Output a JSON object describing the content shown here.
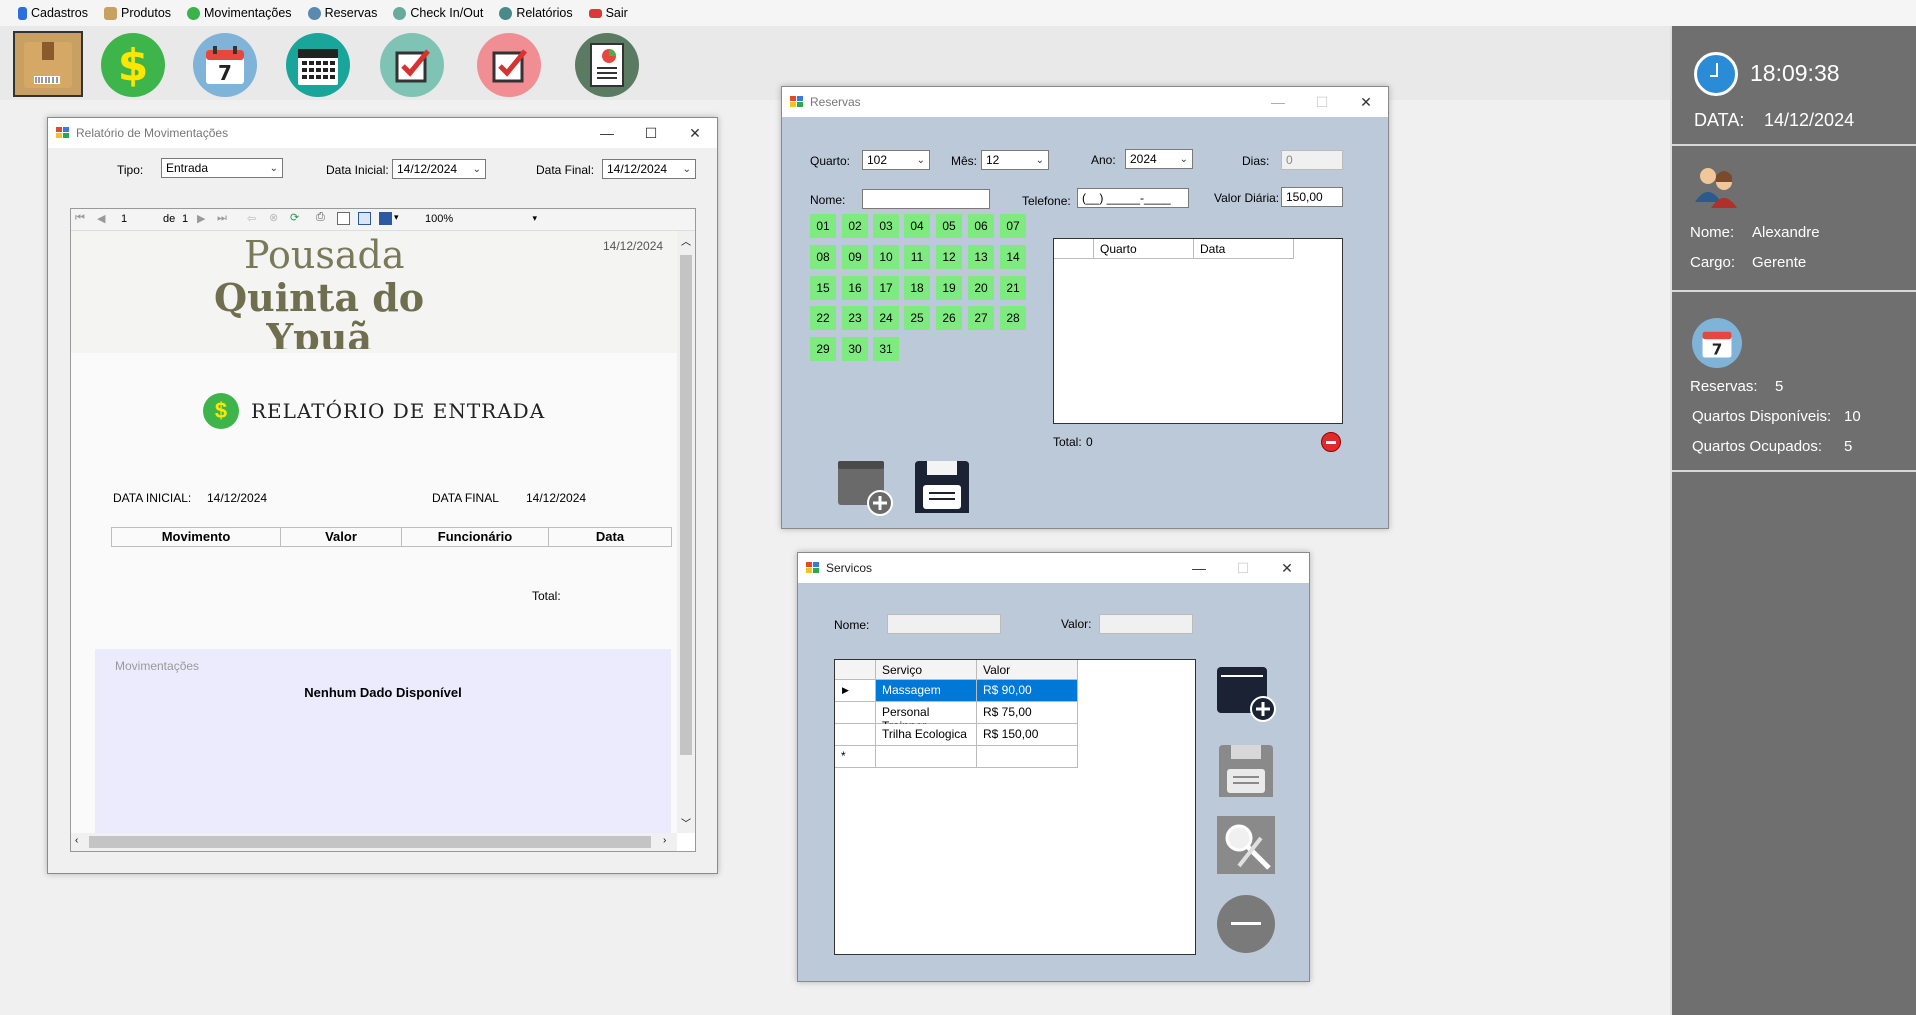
{
  "menu": [
    {
      "label": "Cadastros",
      "color": "#2a6ee0"
    },
    {
      "label": "Produtos",
      "color": "#c8a060"
    },
    {
      "label": "Movimentações",
      "color": "#39b34a"
    },
    {
      "label": "Reservas",
      "color": "#5a8ab0"
    },
    {
      "label": "Check In/Out",
      "color": "#6aaa9a"
    },
    {
      "label": "Relatórios",
      "color": "#4a8a8a"
    },
    {
      "label": "Sair",
      "color": "#d83a3a"
    }
  ],
  "toolbar": {
    "icons": [
      "product-box-icon",
      "money-dollar-icon",
      "calendar-7-icon",
      "calendar-month-icon",
      "checkin-check-icon",
      "checkout-check-icon",
      "report-icon"
    ],
    "colors": [
      "#c8995a",
      "#3db54a",
      "#7fb3d8",
      "#1aa59b",
      "#7ec3b4",
      "#f08e93",
      "#5a7a62"
    ]
  },
  "side": {
    "time": "18:09:38",
    "date_label": "DATA:",
    "date": "14/12/2024",
    "nome_label": "Nome:",
    "nome": "Alexandre",
    "cargo_label": "Cargo:",
    "cargo": "Gerente",
    "reservas_label": "Reservas:",
    "reservas": "5",
    "disp_label": "Quartos Disponíveis:",
    "disp": "10",
    "ocup_label": "Quartos Ocupados:",
    "ocup": "5"
  },
  "relatorio": {
    "title": "Relatório de Movimentações",
    "tipo_label": "Tipo:",
    "tipo": "Entrada",
    "data_inicial_label": "Data Inicial:",
    "data_inicial": "14/12/2024",
    "data_final_label": "Data Final:",
    "data_final": "14/12/2024",
    "page": "1",
    "page_of": "de",
    "page_total": "1",
    "zoom": "100%",
    "report": {
      "date": "14/12/2024",
      "logo_line1": "Pousada",
      "logo_line2": "Quinta do",
      "logo_line3": "Ypuã",
      "heading": "RELATÓRIO DE ENTRADA",
      "di_label": "DATA INICIAL:",
      "di": "14/12/2024",
      "df_label": "DATA FINAL",
      "df": "14/12/2024",
      "columns": [
        "Movimento",
        "Valor",
        "Funcionário",
        "Data"
      ],
      "total_label": "Total:",
      "chart_title": "Movimentações",
      "no_data": "Nenhum Dado Disponível"
    }
  },
  "reservas": {
    "title": "Reservas",
    "quarto_label": "Quarto:",
    "quarto": "102",
    "mes_label": "Mês:",
    "mes": "12",
    "ano_label": "Ano:",
    "ano": "2024",
    "dias_label": "Dias:",
    "dias": "0",
    "nome_label": "Nome:",
    "nome": "",
    "telefone_label": "Telefone:",
    "telefone": "(__) _____-____",
    "valor_label": "Valor Diária:",
    "valor": "150,00",
    "days": [
      "01",
      "02",
      "03",
      "04",
      "05",
      "06",
      "07",
      "08",
      "09",
      "10",
      "11",
      "12",
      "13",
      "14",
      "15",
      "16",
      "17",
      "18",
      "19",
      "20",
      "21",
      "22",
      "23",
      "24",
      "25",
      "26",
      "27",
      "28",
      "29",
      "30",
      "31"
    ],
    "grid_columns": [
      "Quarto",
      "Data"
    ],
    "total_label": "Total:",
    "total": "0"
  },
  "servicos": {
    "title": "Servicos",
    "nome_label": "Nome:",
    "valor_label": "Valor:",
    "columns": [
      "Serviço",
      "Valor"
    ],
    "rows": [
      {
        "servico": "Massagem",
        "valor": "R$ 90,00"
      },
      {
        "servico": "Personal Trainner",
        "valor": "R$ 75,00"
      },
      {
        "servico": "Trilha Ecologica",
        "valor": "R$ 150,00"
      }
    ],
    "new_row_marker": "*"
  }
}
